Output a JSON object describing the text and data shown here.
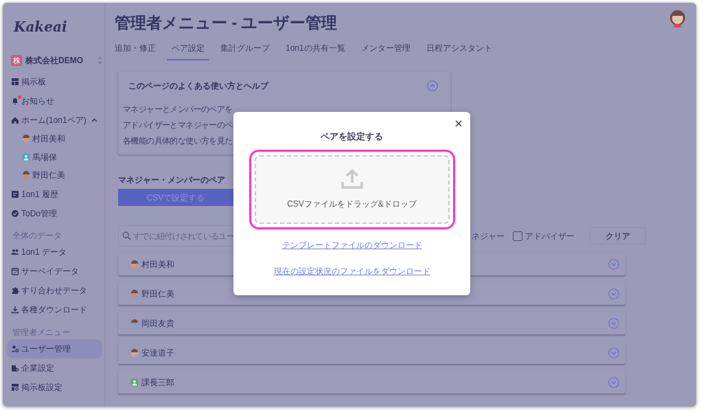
{
  "logo": "Kakeai",
  "title": "管理者メニュー - ユーザー管理",
  "sidebar": {
    "company_badge": "株",
    "company": "株式会社DEMO",
    "items": [
      {
        "kind": "link",
        "label": "掲示板",
        "selected": false
      },
      {
        "kind": "link",
        "label": "お知らせ",
        "selected": false,
        "unread": true
      },
      {
        "kind": "link",
        "label": "ホーム(1on1ペア)",
        "selected": false,
        "expanded": true,
        "children": [
          {
            "kind": "person",
            "label": "村田美和",
            "selected": false
          },
          {
            "kind": "person",
            "label": "馬場保",
            "selected": false
          },
          {
            "kind": "person",
            "label": "野田仁美",
            "selected": false
          }
        ]
      },
      {
        "kind": "link",
        "label": "1on1 履歴",
        "selected": false
      },
      {
        "kind": "link",
        "label": "ToDo管理",
        "selected": false
      },
      {
        "kind": "section",
        "label": "全体のデータ"
      },
      {
        "kind": "link",
        "label": "1on1 データ",
        "selected": false
      },
      {
        "kind": "link",
        "label": "サーベイデータ",
        "selected": false
      },
      {
        "kind": "link",
        "label": "すり合わせデータ",
        "selected": false
      },
      {
        "kind": "link",
        "label": "各種ダウンロード",
        "selected": false
      },
      {
        "kind": "section",
        "label": "管理者メニュー"
      },
      {
        "kind": "link",
        "label": "ユーザー管理",
        "selected": true
      },
      {
        "kind": "link",
        "label": "企業設定",
        "selected": false
      },
      {
        "kind": "link",
        "label": "掲示板設定",
        "selected": false
      }
    ]
  },
  "tabs": [
    {
      "label": "追加・修正",
      "selected": false
    },
    {
      "label": "ペア設定",
      "selected": true
    },
    {
      "label": "集計グループ",
      "selected": false
    },
    {
      "label": "1on1の共有一覧",
      "selected": false
    },
    {
      "label": "メンター管理",
      "selected": false
    },
    {
      "label": "日程アシスタント",
      "selected": false
    }
  ],
  "help": {
    "title": "このページのよくある使い方とヘルプ",
    "expanded": true,
    "lines": [
      "マネジャーとメンバーのペアを",
      "アドバイザーとマネジャーのペ",
      "各機能の具体的な使い方を見た"
    ]
  },
  "pairs": {
    "heading": "マネジャー・メンバーのペア",
    "csv_button": "CSVで設定する",
    "search": {
      "placeholder": "すでに紐付けされているユー"
    },
    "partial_filter_label": "ネジャー",
    "filters": [
      {
        "label": "アドバイザー",
        "checked": false
      }
    ],
    "clear_button": "クリア",
    "rows": [
      {
        "name": "村田美和",
        "expanded": false
      },
      {
        "name": "野田仁美",
        "expanded": false
      },
      {
        "name": "岡田友貴",
        "expanded": false
      },
      {
        "name": "安達道子",
        "expanded": false
      },
      {
        "name": "課長三郎",
        "expanded": false
      }
    ]
  },
  "modal": {
    "title": "ペアを設定する",
    "dropzone": "CSVファイルをドラッグ&ドロップ",
    "links": [
      "テンプレートファイルのダウンロード",
      "現在の設定状況のファイルをダウンロード"
    ]
  }
}
